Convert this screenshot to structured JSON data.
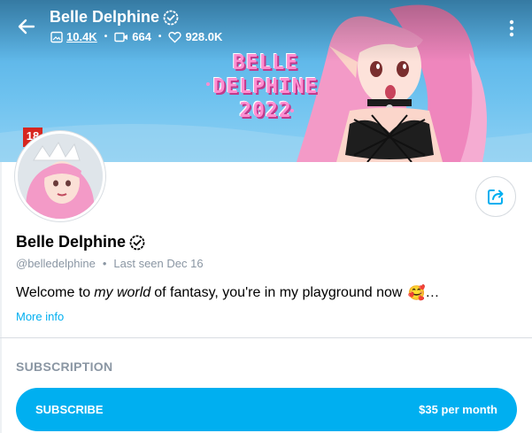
{
  "header": {
    "name": "Belle Delphine",
    "photos_count": "10.4K",
    "videos_count": "664",
    "likes_count": "928.0K",
    "icons": [
      "back-arrow-icon",
      "photo-icon",
      "video-icon",
      "heart-icon",
      "verified-icon",
      "more-vertical-icon"
    ]
  },
  "banner": {
    "title_line1": "BELLE",
    "title_line2": "DELPHINE",
    "title_line3": "2022",
    "age_badge": "18"
  },
  "profile": {
    "name": "Belle Delphine",
    "handle": "@belledelphine",
    "last_seen": "Last seen Dec 16",
    "bio_before": "Welcome to",
    "bio_italic": "my world",
    "bio_after": "of fantasy, you're in my playground now",
    "bio_emoji": "🥰",
    "bio_ellipsis": "…",
    "more_info": "More info"
  },
  "subscription": {
    "title": "SUBSCRIPTION",
    "button_label": "SUBSCRIBE",
    "price": "$35 per month"
  },
  "colors": {
    "accent": "#00aff0",
    "muted": "#8a96a3",
    "banner_sky": "#6ec2ef",
    "hair_pink": "#f39ac7"
  }
}
